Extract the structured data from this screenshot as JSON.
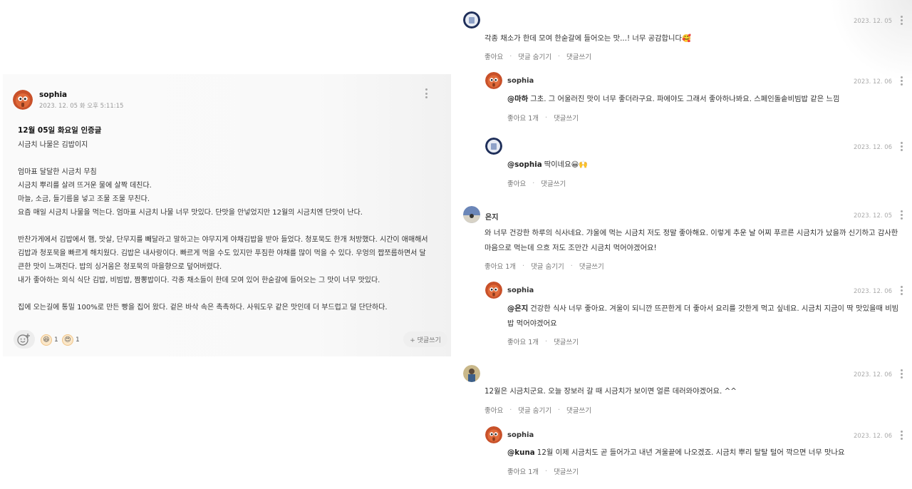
{
  "post": {
    "author": "sophia",
    "date": "2023. 12. 05 화 오후 5:11:15",
    "title": "12월 05일 화요일 인증글",
    "body": [
      "시금치 나물은 김밥이지",
      "",
      "엄마표 달달한 시금치 무침",
      "시금치 뿌리를 살려 뜨거운 물에 살짝 데친다.",
      "마늘, 소금, 들기름을 넣고 조물 조물 무친다.",
      "요즘 매일 시금치 나물을 먹는다. 엄마표 시금치 나물 너무 맛있다. 단맛을 안넣었지만 12월의 시금치엔 단맛이 난다.",
      "",
      "반찬가게에서 김밥에서 햄, 맛살, 단무지를 빼달라고 말하고는 야무지게 야채김밥을 받아 들었다. 청포묵도 한개 처방했다. 시간이 애매해서",
      "김밥과 청포묵을 빠르게 해치웠다. 김밥은 내사랑이다. 빠르게 먹을 수도 있지만 푸짐한 야채를 많이 먹을 수 있다. 우엉의 짭쪼름하면서 달",
      "큰한 맛이 느껴진다. 밥의 싱거움은 청포묵의 마을향으로 덮어버렸다.",
      "내가 좋아하는 외식 식단 김밥, 비빔밥, 짬뽕밥이다. 각종 채소들이 한데 모여 있어 한숟갈에 들어오는 그 맛이 너무 맛있다.",
      "",
      "집에 오는길에 통밀 100%로 만든 빵을 집어 왔다. 겉은 바삭 속은 촉촉하다. 사워도우 같은 맛인데 더 부드럽고 덜 단단하다."
    ],
    "reactions": [
      {
        "icon": "laughing-emoji-icon",
        "count": "1"
      },
      {
        "icon": "heart-eyes-emoji-icon",
        "count": "1"
      }
    ],
    "reply_button": "+ 댓글쓰기"
  },
  "comments": [
    {
      "name": "",
      "date": "2023. 12. 05",
      "mention": "",
      "lines": [
        "각종 채소가 한데 모여 한숟갈에 들어오는 맛...! 너무 공감합니다🥰"
      ],
      "actions": [
        "좋아요",
        "댓글 숨기기",
        "댓글쓰기"
      ]
    },
    {
      "name": "sophia",
      "date": "2023. 12. 06",
      "mention": "@마하",
      "lines": [
        "그초. 그 어울러진 맛이 너무 좋더라구요. 파에야도 그래서 좋아하나봐요. 스페인돌솥비빔밥 같은 느낌"
      ],
      "actions": [
        "좋아요 1개",
        "댓글쓰기"
      ]
    },
    {
      "name": "",
      "date": "2023. 12. 06",
      "mention": "@sophia",
      "lines": [
        "딱이네요😀🙌"
      ],
      "actions": [
        "좋아요",
        "댓글쓰기"
      ]
    },
    {
      "name": "은지",
      "date": "2023. 12. 05",
      "mention": "",
      "lines": [
        "와 너무 건강한 하루의 식사네요. 갸울에 먹는 시금치 저도 정말 좋아해요. 이렇게 추운 날 어찌 푸르른 시금치가 났을까 신기하고 감사한",
        "마음으로 먹는데 으흐 저도 조만간 시금치 먹어야겠어요!"
      ],
      "actions": [
        "좋아요 1개",
        "댓글 숨기기",
        "댓글쓰기"
      ]
    },
    {
      "name": "sophia",
      "date": "2023. 12. 06",
      "mention": "@은지",
      "lines": [
        "건강한 식사 너무 좋아요. 겨울이 되니깐 뜨끈한게 더 좋아서 요리를 갓한게 먹고 싶네요. 시금치 지금이 딱 맛있을때 비빔",
        "밥 먹어야겠어요"
      ],
      "actions": [
        "좋아요 1개",
        "댓글쓰기"
      ]
    },
    {
      "name": "",
      "date": "2023. 12. 06",
      "mention": "",
      "lines": [
        "12월은 시금치군요. 오늘 장보러 갈 때 시금치가 보이면 얼른 데러와야겠어요. ^^"
      ],
      "actions": [
        "좋아요",
        "댓글 숨기기",
        "댓글쓰기"
      ]
    },
    {
      "name": "sophia",
      "date": "2023. 12. 06",
      "mention": "@kuna",
      "lines": [
        "12월 이제 시금치도 곧 들어가고 내년 겨울끝에 나오겠죠. 시금치 뿌리 탈탈 털어 깍으면 너무 맛나요"
      ],
      "actions": [
        "좋아요 1개",
        "댓글쓰기"
      ]
    }
  ]
}
